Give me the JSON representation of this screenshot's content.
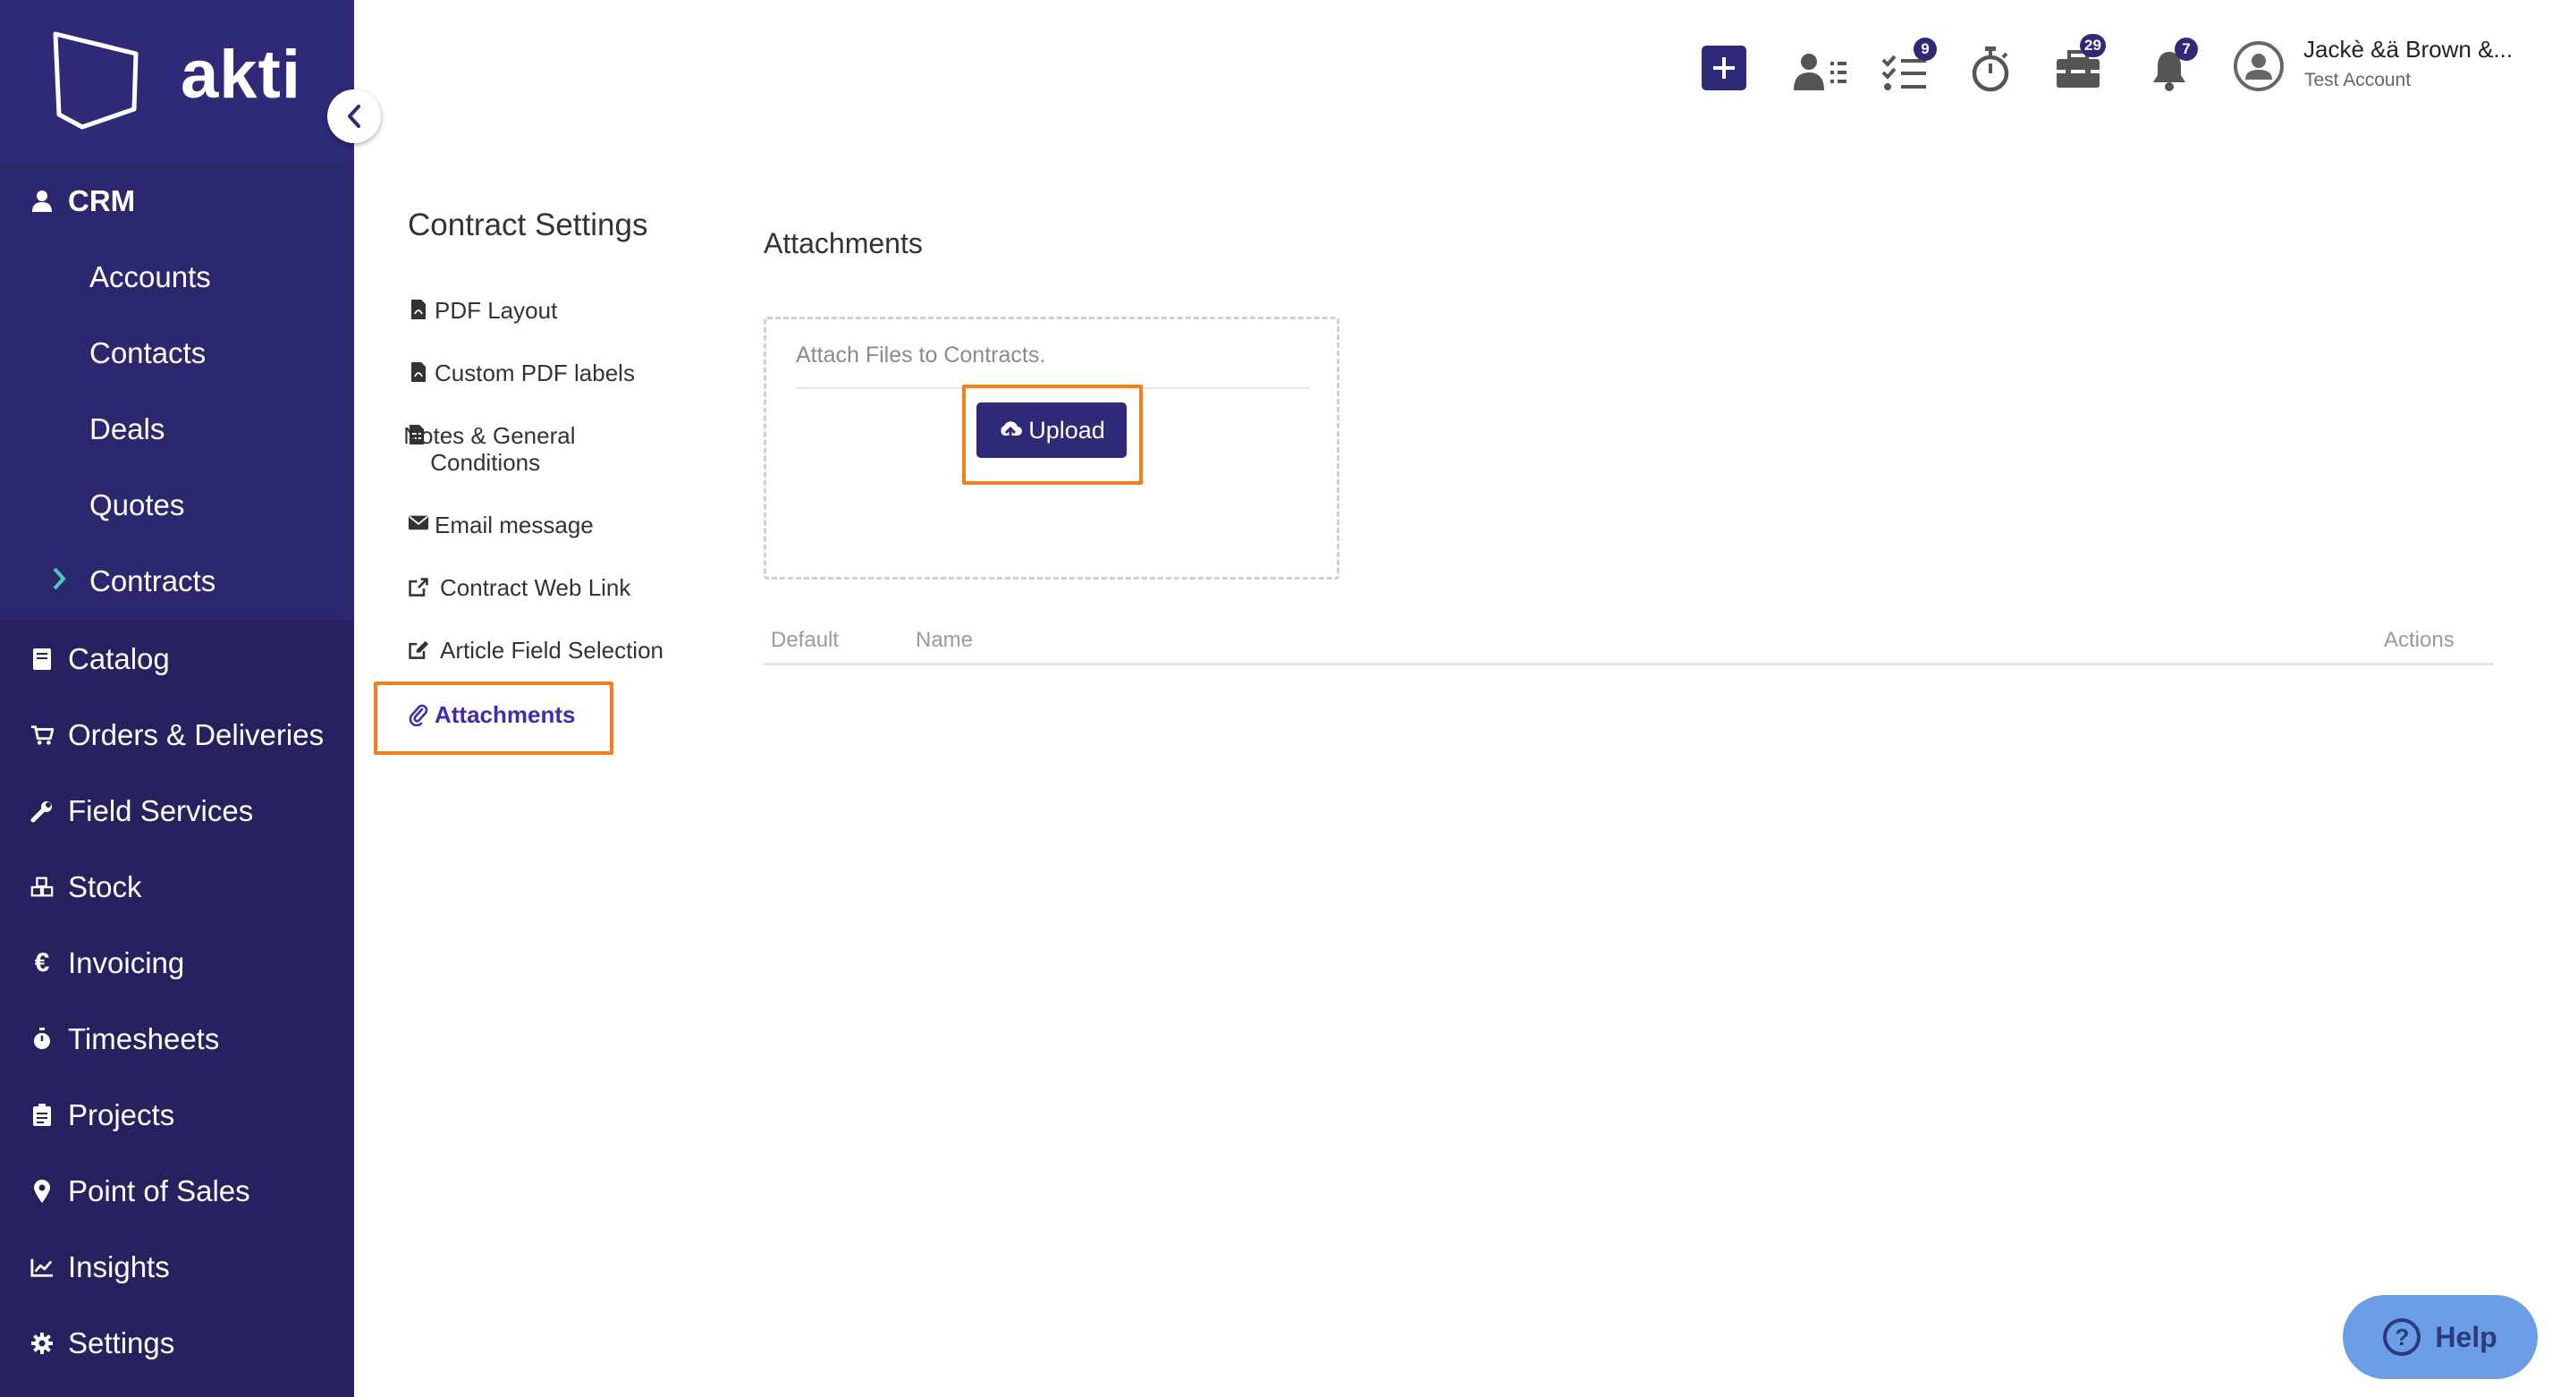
{
  "app": {
    "logo_text": "akti"
  },
  "sidebar": {
    "sections": [
      {
        "label": "CRM",
        "icon": "user-icon"
      },
      {
        "label": "Catalog",
        "icon": "book-icon"
      },
      {
        "label": "Orders & Deliveries",
        "icon": "cart-icon"
      },
      {
        "label": "Field Services",
        "icon": "wrench-icon"
      },
      {
        "label": "Stock",
        "icon": "cubes-icon"
      },
      {
        "label": "Invoicing",
        "icon": "euro-icon"
      },
      {
        "label": "Timesheets",
        "icon": "stopwatch-icon"
      },
      {
        "label": "Projects",
        "icon": "clipboard-icon"
      },
      {
        "label": "Point of Sales",
        "icon": "map-marker-icon"
      },
      {
        "label": "Insights",
        "icon": "chart-line-icon"
      },
      {
        "label": "Settings",
        "icon": "gear-icon"
      }
    ],
    "crm_items": [
      {
        "label": "Accounts"
      },
      {
        "label": "Contacts"
      },
      {
        "label": "Deals"
      },
      {
        "label": "Quotes"
      },
      {
        "label": "Contracts",
        "active": true
      }
    ]
  },
  "topbar": {
    "badges": {
      "tasks": "9",
      "toolbox": "29",
      "notifications": "7"
    },
    "user_name": "Jackè &ä Brown &...",
    "user_account": "Test Account"
  },
  "settings_menu": {
    "title": "Contract Settings",
    "items": [
      {
        "label": "PDF Layout",
        "icon": "pdf-file-icon"
      },
      {
        "label": "Custom PDF labels",
        "icon": "pdf-file-icon"
      },
      {
        "label": "Notes & General Conditions",
        "icon": "document-icon"
      },
      {
        "label": "Email message",
        "icon": "envelope-icon"
      },
      {
        "label": "Contract Web Link",
        "icon": "external-link-icon"
      },
      {
        "label": "Article Field Selection",
        "icon": "edit-icon"
      },
      {
        "label": "Attachments",
        "icon": "paperclip-icon",
        "active": true
      }
    ]
  },
  "attachments": {
    "title": "Attachments",
    "dropzone_label": "Attach Files to Contracts.",
    "upload_label": "Upload",
    "table_headers": {
      "default": "Default",
      "name": "Name",
      "actions": "Actions"
    }
  },
  "help": {
    "label": "Help"
  },
  "colors": {
    "sidebar": "#27225f",
    "accent": "#2f2a78",
    "highlight": "#f08020",
    "help": "#6b9ee6"
  }
}
